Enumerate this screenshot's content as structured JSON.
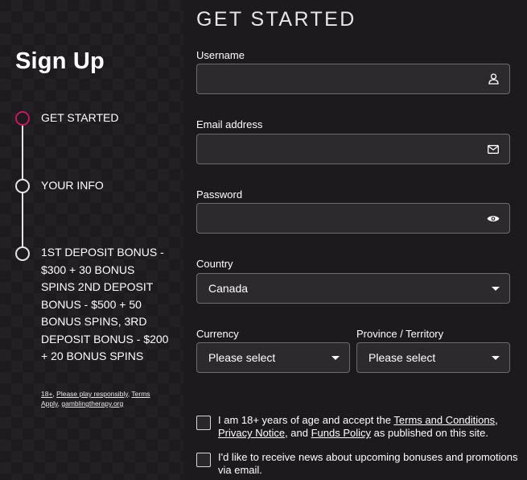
{
  "left": {
    "title": "Sign Up",
    "steps": [
      {
        "label": "GET STARTED"
      },
      {
        "label": "YOUR INFO"
      },
      {
        "label": "1ST DEPOSIT BONUS - $300 + 30 BONUS SPINS 2ND DEPOSIT BONUS - $500 + 50 BONUS SPINS, 3RD DEPOSIT BONUS - $200 + 20 BONUS SPINS"
      }
    ],
    "disclaimer": {
      "part1": "18+",
      "sep1": ", ",
      "part2": "Please play responsibly",
      "sep2": ", ",
      "part3": "Terms Apply",
      "sep3": ", ",
      "part4": "gamblingtherapy.org"
    }
  },
  "form": {
    "title": "GET STARTED",
    "username_label": "Username",
    "username_value": "",
    "email_label": "Email address",
    "email_value": "",
    "password_label": "Password",
    "password_value": "",
    "country_label": "Country",
    "country_value": "Canada",
    "currency_label": "Currency",
    "currency_value": "Please select",
    "province_label": "Province / Territory",
    "province_value": "Please select"
  },
  "consent": {
    "terms_prefix": "I am 18+ years of age and accept the ",
    "terms_link": "Terms and Conditions",
    "terms_sep1": ", ",
    "privacy_link": "Privacy Notice",
    "terms_sep2": ", and ",
    "funds_link": "Funds Policy",
    "terms_suffix": " as published on this site.",
    "news_text": "I'd like to receive news about upcoming bonuses and promotions via email."
  },
  "colors": {
    "accent": "#c4185f",
    "background": "#1c1a1c",
    "input_bg": "#2d2a2d",
    "input_border": "#6e6b6e"
  },
  "icons": {
    "username": "user-icon",
    "email": "envelope-icon",
    "password": "eye-icon",
    "select": "caret-down-icon"
  }
}
